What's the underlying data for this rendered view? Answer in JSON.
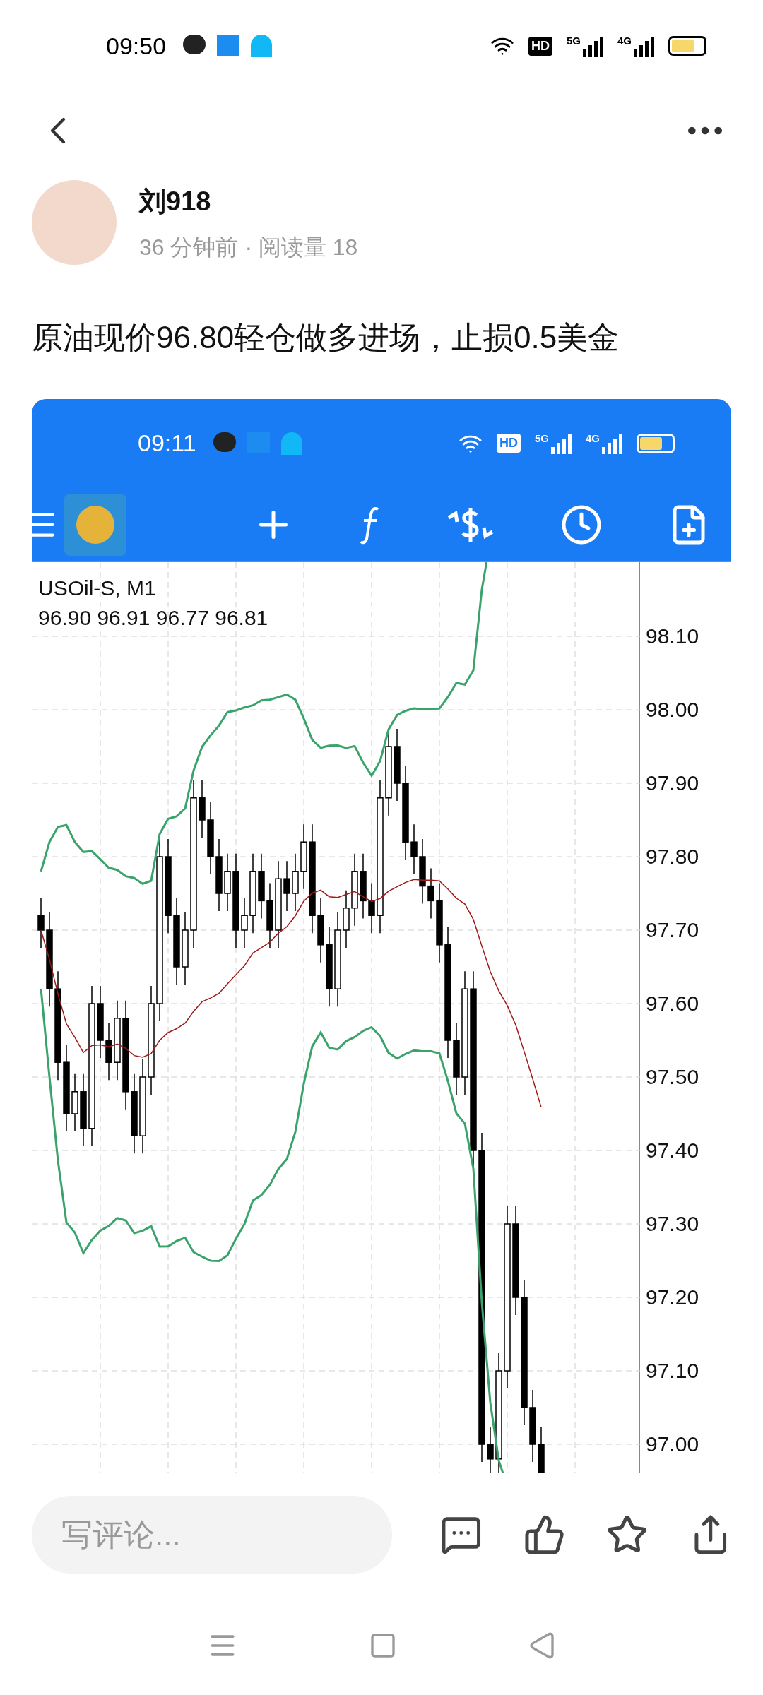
{
  "status_bar": {
    "time": "09:50",
    "indicators": [
      "HD",
      "5G",
      "4G"
    ]
  },
  "author": {
    "name": "刘918",
    "meta": "36 分钟前 · 阅读量 18"
  },
  "post": {
    "text": "原油现价96.80轻仓做多进场，止损0.5美金"
  },
  "screenshot": {
    "status_bar": {
      "time": "09:11",
      "indicators": [
        "HD",
        "5G",
        "4G"
      ]
    },
    "chart": {
      "symbol": "USOil-S, M1",
      "ohlc": "96.90 96.91 96.77 96.81",
      "price_labels": [
        "98.10",
        "98.00",
        "97.90",
        "97.80",
        "97.70",
        "97.60",
        "97.50",
        "97.40",
        "97.30",
        "97.20",
        "97.10",
        "97.00"
      ]
    }
  },
  "comment_bar": {
    "placeholder": "写评论..."
  }
}
